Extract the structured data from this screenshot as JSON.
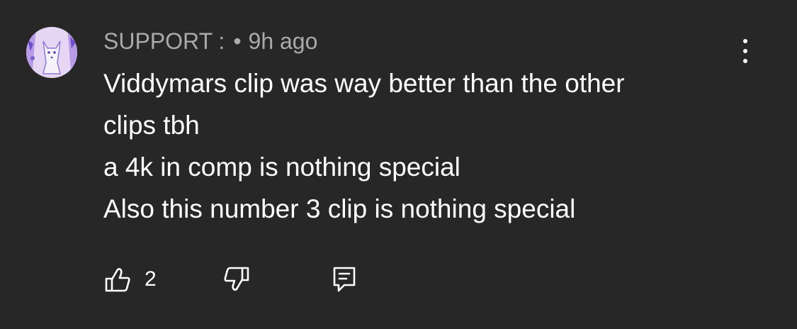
{
  "comment": {
    "author": "SUPPORT :",
    "separator": "•",
    "timestamp": "9h ago",
    "lines": [
      "Viddymars clip was way better than the other",
      "clips tbh",
      "a 4k in comp is nothing special",
      "Also this number 3 clip is nothing special"
    ],
    "like_count": "2"
  },
  "icons": {
    "avatar": "wolf-avatar-icon",
    "menu": "more-vertical-icon",
    "like": "thumbs-up-icon",
    "dislike": "thumbs-down-icon",
    "reply": "reply-comment-icon"
  },
  "colors": {
    "background": "#272727",
    "text": "#ffffff",
    "meta_text": "#aaaaaa",
    "avatar_bg": "#e6d6f3",
    "avatar_accent": "#7a5fd0"
  }
}
